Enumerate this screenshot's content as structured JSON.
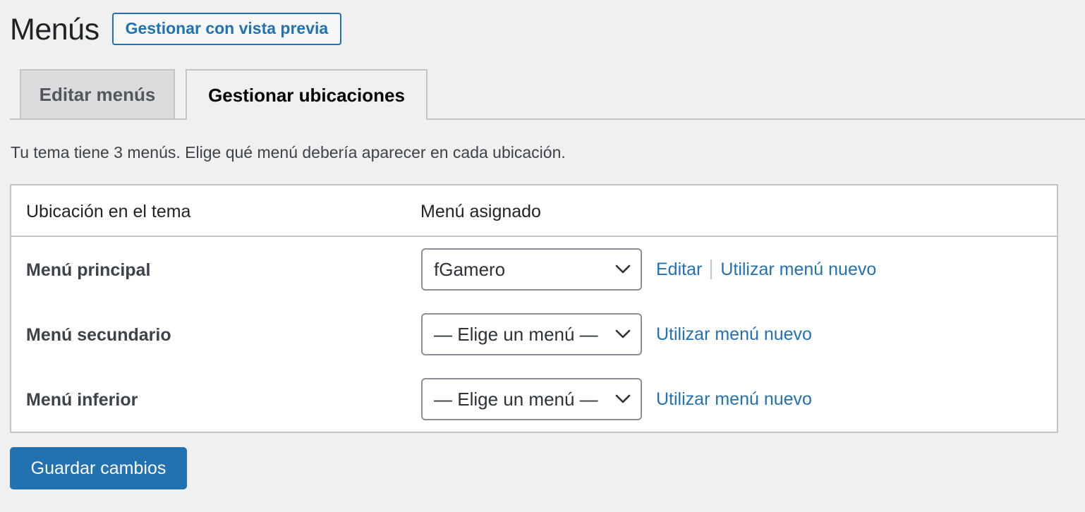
{
  "header": {
    "title": "Menús",
    "preview_button": "Gestionar con vista previa"
  },
  "tabs": [
    {
      "label": "Editar menús",
      "active": false
    },
    {
      "label": "Gestionar ubicaciones",
      "active": true
    }
  ],
  "description": "Tu tema tiene 3 menús. Elige qué menú debería aparecer en cada ubicación.",
  "table": {
    "columns": [
      "Ubicación en el tema",
      "Menú asignado"
    ],
    "rows": [
      {
        "location": "Menú principal",
        "selected": "fGamero",
        "edit_link": "Editar",
        "new_link": "Utilizar menú nuevo"
      },
      {
        "location": "Menú secundario",
        "selected": "— Elige un menú —",
        "new_link": "Utilizar menú nuevo"
      },
      {
        "location": "Menú inferior",
        "selected": "— Elige un menú —",
        "new_link": "Utilizar menú nuevo"
      }
    ]
  },
  "save_button": "Guardar cambios",
  "icons": {
    "select_arrow": "chevron-down-icon"
  },
  "colors": {
    "accent": "#2271b1",
    "background": "#f0f0f1",
    "panel": "#ffffff",
    "border": "#c3c4c7"
  }
}
